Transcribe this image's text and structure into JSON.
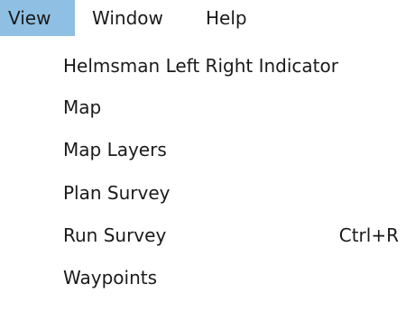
{
  "menubar": {
    "items": [
      {
        "label": "View",
        "active": true
      },
      {
        "label": "Window",
        "active": false
      },
      {
        "label": "Help",
        "active": false
      }
    ],
    "active_color": "#8fbfe3"
  },
  "view_menu": {
    "items": [
      {
        "label": "Helmsman Left Right Indicator",
        "shortcut": ""
      },
      {
        "label": "Map",
        "shortcut": ""
      },
      {
        "label": "Map Layers",
        "shortcut": ""
      },
      {
        "label": "Plan Survey",
        "shortcut": ""
      },
      {
        "label": "Run Survey",
        "shortcut": "Ctrl+R"
      },
      {
        "label": "Waypoints",
        "shortcut": ""
      }
    ]
  }
}
